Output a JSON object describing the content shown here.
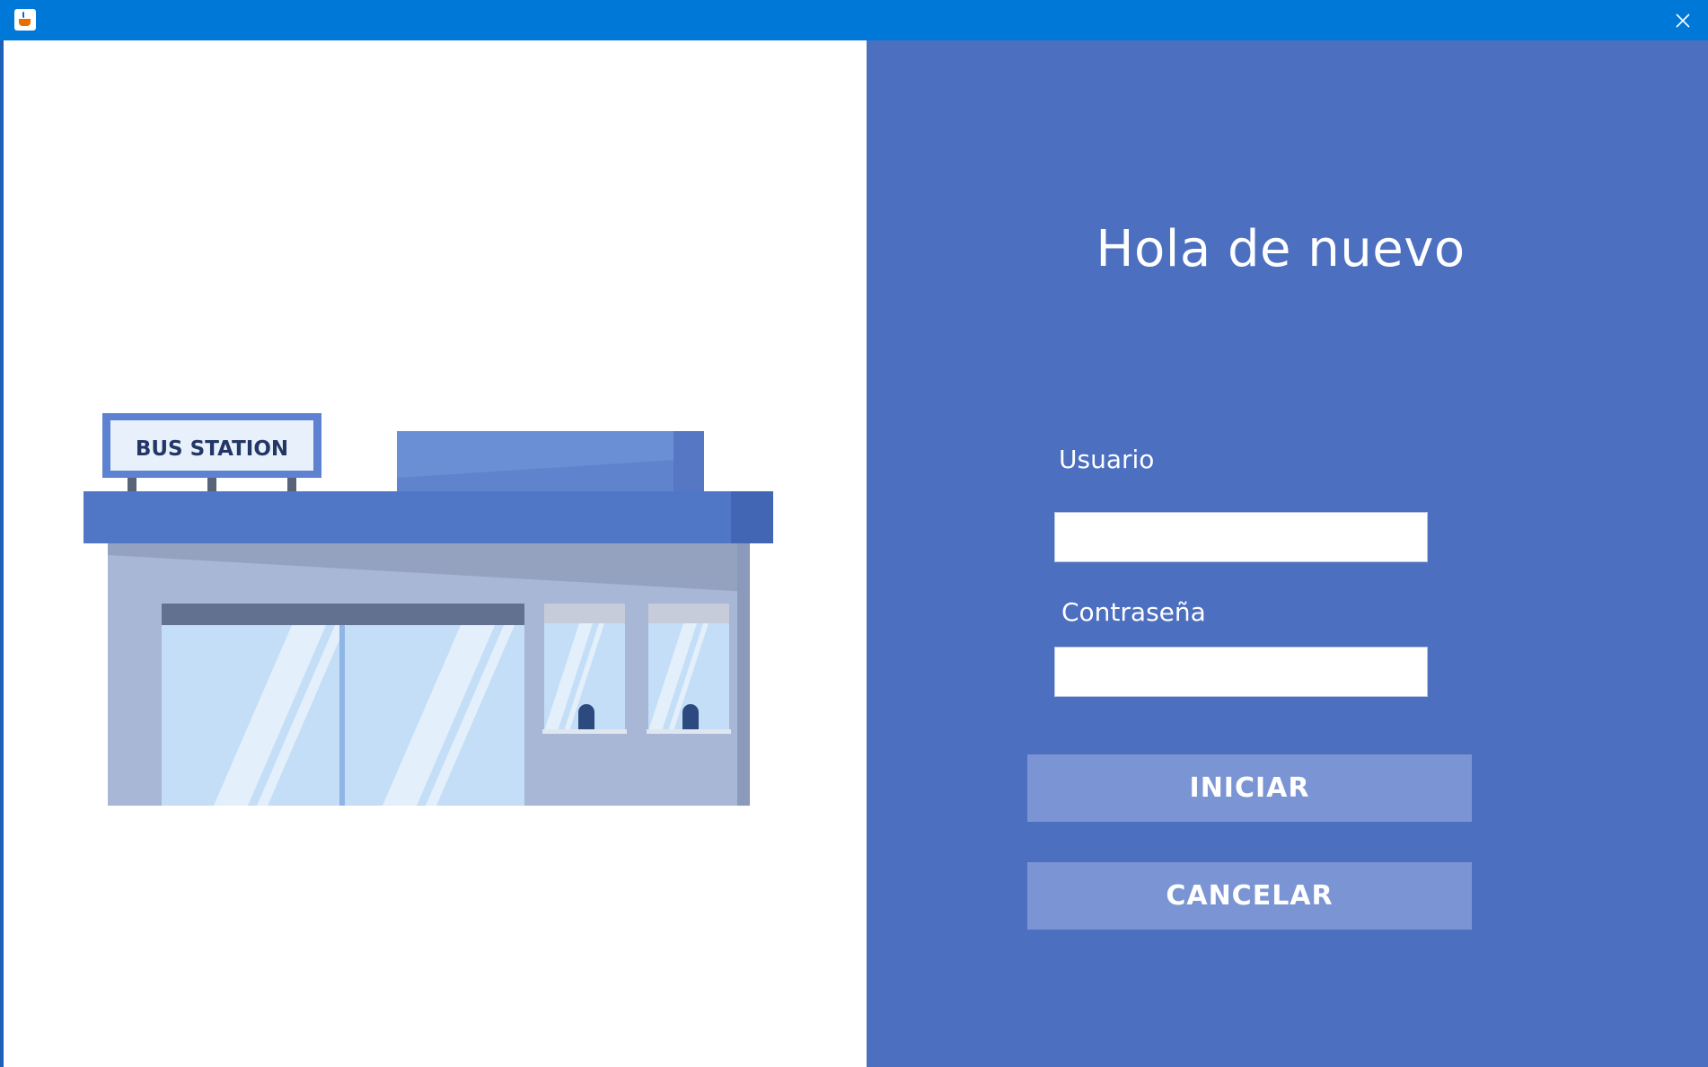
{
  "window": {
    "app_icon": "java-cup-icon",
    "close_icon": "close-icon",
    "titlebar_color": "#0078d7"
  },
  "illustration": {
    "sign_text": "BUS STATION"
  },
  "login": {
    "greeting": "Hola de nuevo",
    "username_label": "Usuario",
    "username_value": "",
    "password_label": "Contraseña",
    "password_value": "",
    "submit_label": "INICIAR",
    "cancel_label": "CANCELAR",
    "panel_color": "#4c6fc0",
    "button_color": "#7b95d4"
  }
}
